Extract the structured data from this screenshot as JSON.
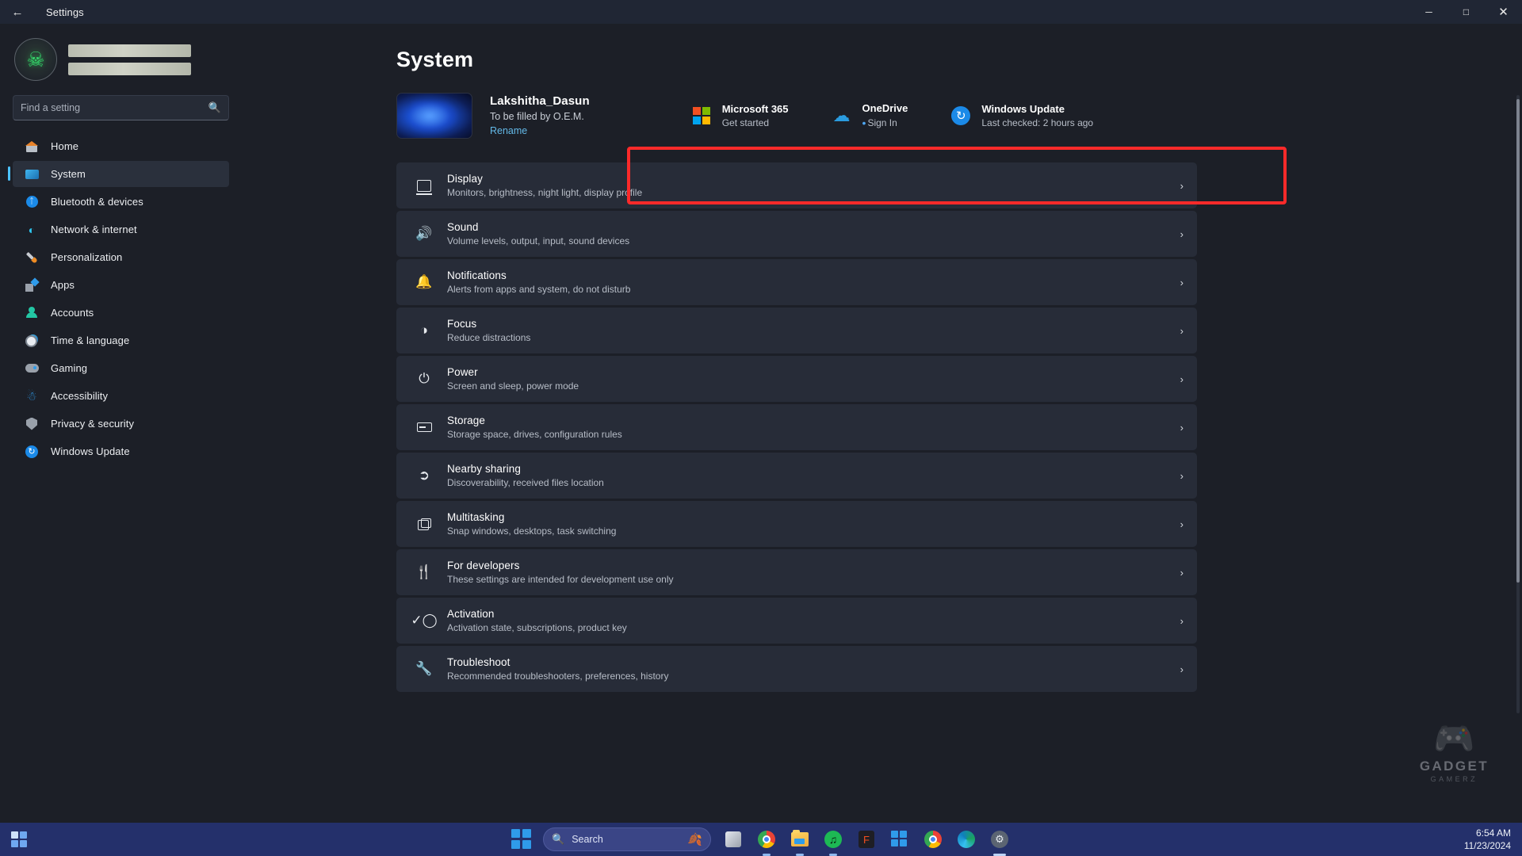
{
  "window": {
    "title": "Settings",
    "back_icon": "back-arrow-icon",
    "minimize_label": "─",
    "maximize_label": "□",
    "close_label": "✕"
  },
  "sidebar": {
    "profile": {
      "avatar_icon": "user-avatar-skull-logo",
      "name_redacted": "",
      "email_redacted": ""
    },
    "search": {
      "placeholder": "Find a setting",
      "value": "",
      "icon": "search-icon"
    },
    "items": [
      {
        "label": "Home",
        "icon": "home-icon",
        "active": false
      },
      {
        "label": "System",
        "icon": "system-monitor-icon",
        "active": true
      },
      {
        "label": "Bluetooth & devices",
        "icon": "bluetooth-icon",
        "active": false
      },
      {
        "label": "Network & internet",
        "icon": "wifi-icon",
        "active": false
      },
      {
        "label": "Personalization",
        "icon": "paintbrush-icon",
        "active": false
      },
      {
        "label": "Apps",
        "icon": "apps-icon",
        "active": false
      },
      {
        "label": "Accounts",
        "icon": "account-person-icon",
        "active": false
      },
      {
        "label": "Time & language",
        "icon": "clock-globe-icon",
        "active": false
      },
      {
        "label": "Gaming",
        "icon": "gamepad-icon",
        "active": false
      },
      {
        "label": "Accessibility",
        "icon": "accessibility-person-icon",
        "active": false
      },
      {
        "label": "Privacy & security",
        "icon": "shield-icon",
        "active": false
      },
      {
        "label": "Windows Update",
        "icon": "update-refresh-icon",
        "active": false
      }
    ]
  },
  "main": {
    "page_title": "System",
    "device": {
      "thumbnail_icon": "windows-bloom-wallpaper-thumbnail",
      "name": "Lakshitha_Dasun",
      "model": "To be filled by O.E.M.",
      "rename_label": "Rename"
    },
    "tiles": [
      {
        "title": "Microsoft 365",
        "subtitle": "Get started",
        "icon": "microsoft-logo-icon",
        "has_dot": false
      },
      {
        "title": "OneDrive",
        "subtitle": "Sign In",
        "icon": "onedrive-cloud-icon",
        "has_dot": true
      },
      {
        "title": "Windows Update",
        "subtitle": "Last checked: 2 hours ago",
        "icon": "windows-update-icon",
        "has_dot": false
      }
    ],
    "settings_rows": [
      {
        "title": "Display",
        "subtitle": "Monitors, brightness, night light, display profile",
        "icon": "display-monitor-icon",
        "highlighted": true
      },
      {
        "title": "Sound",
        "subtitle": "Volume levels, output, input, sound devices",
        "icon": "speaker-sound-icon",
        "highlighted": false
      },
      {
        "title": "Notifications",
        "subtitle": "Alerts from apps and system, do not disturb",
        "icon": "bell-notification-icon",
        "highlighted": false
      },
      {
        "title": "Focus",
        "subtitle": "Reduce distractions",
        "icon": "focus-crescent-icon",
        "highlighted": false
      },
      {
        "title": "Power",
        "subtitle": "Screen and sleep, power mode",
        "icon": "power-icon",
        "highlighted": false
      },
      {
        "title": "Storage",
        "subtitle": "Storage space, drives, configuration rules",
        "icon": "storage-drive-icon",
        "highlighted": false
      },
      {
        "title": "Nearby sharing",
        "subtitle": "Discoverability, received files location",
        "icon": "share-icon",
        "highlighted": false
      },
      {
        "title": "Multitasking",
        "subtitle": "Snap windows, desktops, task switching",
        "icon": "multitasking-windows-icon",
        "highlighted": false
      },
      {
        "title": "For developers",
        "subtitle": "These settings are intended for development use only",
        "icon": "developer-tools-icon",
        "highlighted": false
      },
      {
        "title": "Activation",
        "subtitle": "Activation state, subscriptions, product key",
        "icon": "checkmark-circle-icon",
        "highlighted": false
      },
      {
        "title": "Troubleshoot",
        "subtitle": "Recommended troubleshooters, preferences, history",
        "icon": "wrench-icon",
        "highlighted": false
      }
    ],
    "chevron_glyph": "›"
  },
  "watermark": {
    "glyph": "🎮",
    "name": "GADGET",
    "sub": "GAMERZ"
  },
  "taskbar": {
    "widgets_icon": "widgets-icon",
    "start_icon": "start-windows-icon",
    "search": {
      "label": "Search",
      "icon": "search-icon",
      "accent_icon": "leaf-icon"
    },
    "apps": [
      {
        "name": "task-view-icon",
        "glyph": ""
      },
      {
        "name": "chrome-icon",
        "glyph": ""
      },
      {
        "name": "file-explorer-icon",
        "glyph": ""
      },
      {
        "name": "spotify-icon",
        "glyph": "♫"
      },
      {
        "name": "figma-icon",
        "glyph": "F"
      },
      {
        "name": "microsoft-store-icon",
        "glyph": ""
      },
      {
        "name": "chrome-secondary-icon",
        "glyph": ""
      },
      {
        "name": "edge-icon",
        "glyph": ""
      },
      {
        "name": "settings-app-icon",
        "glyph": "⚙"
      }
    ],
    "clock": {
      "time": "6:54 AM",
      "date": "11/23/2024"
    }
  },
  "colors": {
    "accent": "#4cc2ff",
    "highlight_red": "#fc2a2a",
    "taskbar_blue": "#24306b",
    "card_bg": "#272c38",
    "page_bg": "#1c1f27"
  }
}
